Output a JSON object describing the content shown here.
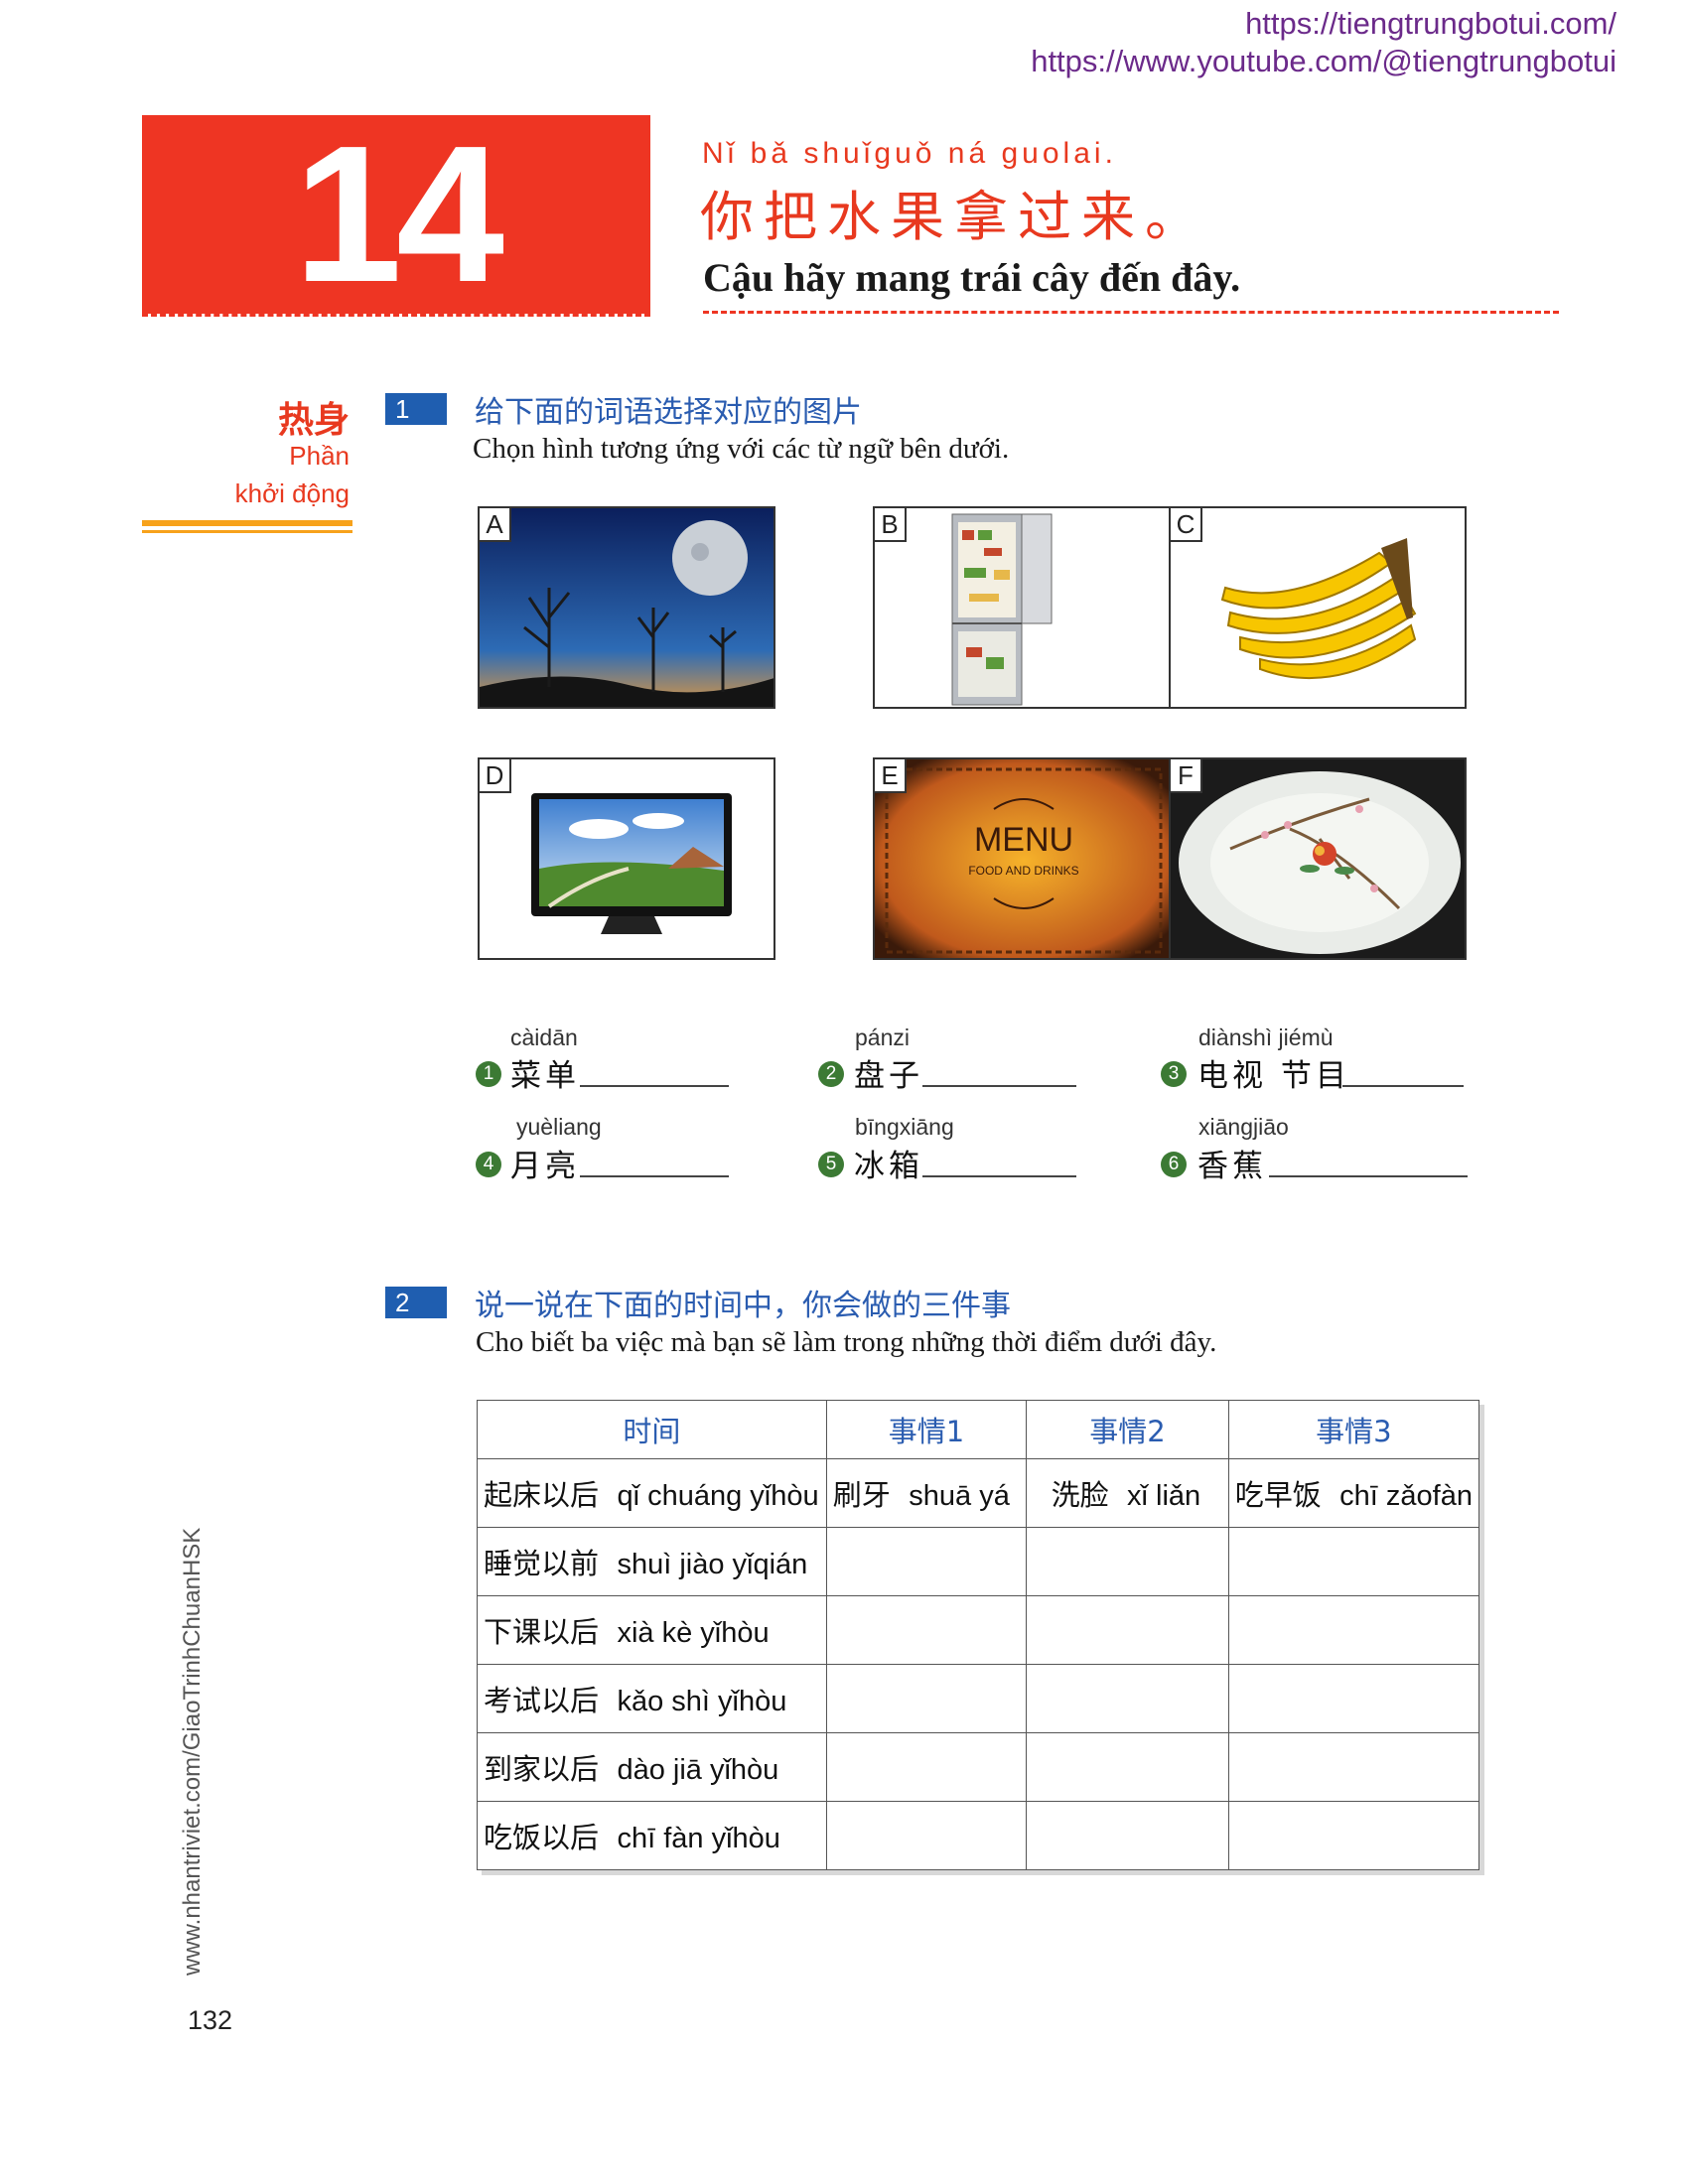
{
  "header_urls": [
    "https://tiengtrungbotui.com/",
    "https://www.youtube.com/@tiengtrungbotui"
  ],
  "lesson": {
    "number": "14",
    "pinyin": "Nǐ  bǎ  shuǐguǒ  ná  guolai.",
    "chinese": "你把水果拿过来。",
    "vietnamese": "Cậu hãy mang trái cây đến đây."
  },
  "warmup": {
    "cn": "热身",
    "vn_line1": "Phần",
    "vn_line2": "khởi động"
  },
  "exercise1": {
    "number": "1",
    "cn": "给下面的词语选择对应的图片",
    "vn": "Chọn hình tương ứng với các từ ngữ bên dưới.",
    "pictures": [
      {
        "label": "A",
        "icon": "moon-night-photo"
      },
      {
        "label": "B",
        "icon": "refrigerator-photo"
      },
      {
        "label": "C",
        "icon": "banana-photo"
      },
      {
        "label": "D",
        "icon": "tv-photo"
      },
      {
        "label": "E",
        "icon": "menu-photo"
      },
      {
        "label": "F",
        "icon": "plate-photo"
      }
    ],
    "menu_text": "MENU",
    "menu_sub": "FOOD AND DRINKS",
    "items": [
      {
        "num": "1",
        "pinyin": "càidān",
        "cn": "菜单"
      },
      {
        "num": "2",
        "pinyin": "pánzi",
        "cn": "盘子"
      },
      {
        "num": "3",
        "pinyin": "diànshì jiémù",
        "cn": "电视 节目"
      },
      {
        "num": "4",
        "pinyin": "yuèliang",
        "cn": "月亮"
      },
      {
        "num": "5",
        "pinyin": "bīngxiāng",
        "cn": "冰箱"
      },
      {
        "num": "6",
        "pinyin": "xiāngjiāo",
        "cn": "香蕉"
      }
    ]
  },
  "exercise2": {
    "number": "2",
    "cn": "说一说在下面的时间中，你会做的三件事",
    "vn": "Cho biết ba việc mà bạn sẽ làm trong những thời điểm dưới đây.",
    "headers": [
      "时间",
      "事情1",
      "事情2",
      "事情3"
    ],
    "rows": [
      {
        "time_cn": "起床以后",
        "time_py": "qǐ chuáng yǐhòu",
        "t1_cn": "刷牙",
        "t1_py": "shuā yá",
        "t2_cn": "洗脸",
        "t2_py": "xǐ liǎn",
        "t3_cn": "吃早饭",
        "t3_py": "chī zǎofàn"
      },
      {
        "time_cn": "睡觉以前",
        "time_py": "shuì jiào yǐqián",
        "t1_cn": "",
        "t1_py": "",
        "t2_cn": "",
        "t2_py": "",
        "t3_cn": "",
        "t3_py": ""
      },
      {
        "time_cn": "下课以后",
        "time_py": "xià kè yǐhòu",
        "t1_cn": "",
        "t1_py": "",
        "t2_cn": "",
        "t2_py": "",
        "t3_cn": "",
        "t3_py": ""
      },
      {
        "time_cn": "考试以后",
        "time_py": "kǎo shì yǐhòu",
        "t1_cn": "",
        "t1_py": "",
        "t2_cn": "",
        "t2_py": "",
        "t3_cn": "",
        "t3_py": ""
      },
      {
        "time_cn": "到家以后",
        "time_py": "dào jiā yǐhòu",
        "t1_cn": "",
        "t1_py": "",
        "t2_cn": "",
        "t2_py": "",
        "t3_cn": "",
        "t3_py": ""
      },
      {
        "time_cn": "吃饭以后",
        "time_py": "chī fàn yǐhòu",
        "t1_cn": "",
        "t1_py": "",
        "t2_cn": "",
        "t2_py": "",
        "t3_cn": "",
        "t3_py": ""
      }
    ]
  },
  "side_url": "www.nhantriviet.com/GiaoTrinhChuanHSK",
  "page_number": "132",
  "colors": {
    "accent_red": "#ee3523",
    "title_red": "#e8391f",
    "blue": "#2a5cb0",
    "badge_blue": "#1f5eb0",
    "orange": "#f7a21b",
    "green": "#3c7a34"
  }
}
